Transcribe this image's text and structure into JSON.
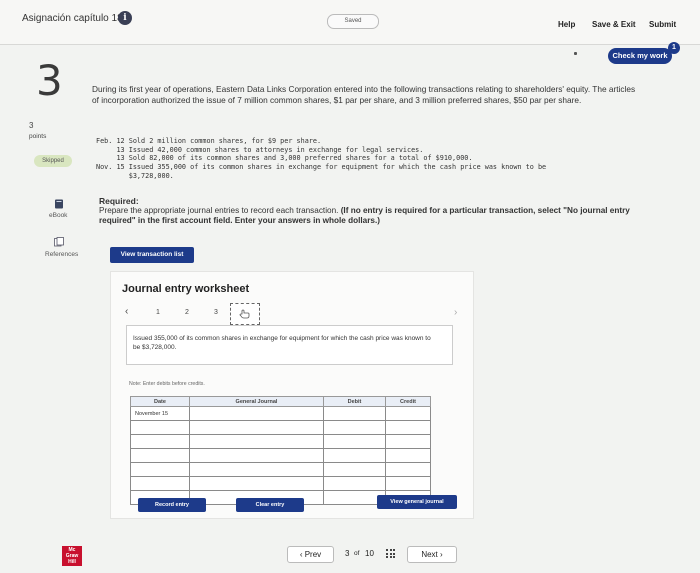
{
  "header": {
    "title": "Asignación capítulo 18",
    "saved_status": "Saved",
    "help": "Help",
    "save_exit": "Save & Exit",
    "submit": "Submit",
    "check_my_work": "Check my work",
    "check_badge": "1"
  },
  "sidebar": {
    "question_number": "3",
    "points_value": "3",
    "points_label": "points",
    "status": "Skipped",
    "ebook_label": "eBook",
    "references_label": "References"
  },
  "problem": {
    "intro": "During its first year of operations, Eastern Data Links Corporation entered into the following transactions relating to shareholders' equity. The articles of incorporation authorized the issue of 7 million common shares, $1 par per share, and 3 million preferred shares, $50 par per share.",
    "transactions": [
      "Feb. 12 Sold 2 million common shares, for $9 per share.",
      "     13 Issued 42,000 common shares to attorneys in exchange for legal services.",
      "     13 Sold 82,000 of its common shares and 3,000 preferred shares for a total of $910,000.",
      "Nov. 15 Issued 355,000 of its common shares in exchange for equipment for which the cash price was known to be",
      "        $3,728,000."
    ],
    "required_title": "Required:",
    "required_plain": "Prepare the appropriate journal entries to record each transaction.",
    "required_bold": "(If no entry is required for a particular transaction, select \"No journal entry required\" in the first account field. Enter your answers in whole dollars.)",
    "view_transaction_list": "View transaction list"
  },
  "worksheet": {
    "title": "Journal entry worksheet",
    "pages": [
      "1",
      "2",
      "3"
    ],
    "description": "Issued 355,000 of its common shares in exchange for equipment for which the cash price was known to be $3,728,000.",
    "note": "Note: Enter debits before credits.",
    "columns": [
      "Date",
      "General Journal",
      "Debit",
      "Credit"
    ],
    "rows": [
      [
        "November 15",
        "",
        "",
        ""
      ],
      [
        "",
        "",
        "",
        ""
      ],
      [
        "",
        "",
        "",
        ""
      ],
      [
        "",
        "",
        "",
        ""
      ],
      [
        "",
        "",
        "",
        ""
      ],
      [
        "",
        "",
        "",
        ""
      ],
      [
        "",
        "",
        "",
        ""
      ]
    ],
    "record_entry": "Record entry",
    "clear_entry": "Clear entry",
    "view_general_journal": "View general journal"
  },
  "footer": {
    "prev": "Prev",
    "page_current": "3",
    "page_of": "of",
    "page_total": "10",
    "next": "Next"
  },
  "colors": {
    "accent": "#1d3a8a",
    "skipped_badge": "#d9e6c0",
    "brand_red": "#c8102e"
  }
}
